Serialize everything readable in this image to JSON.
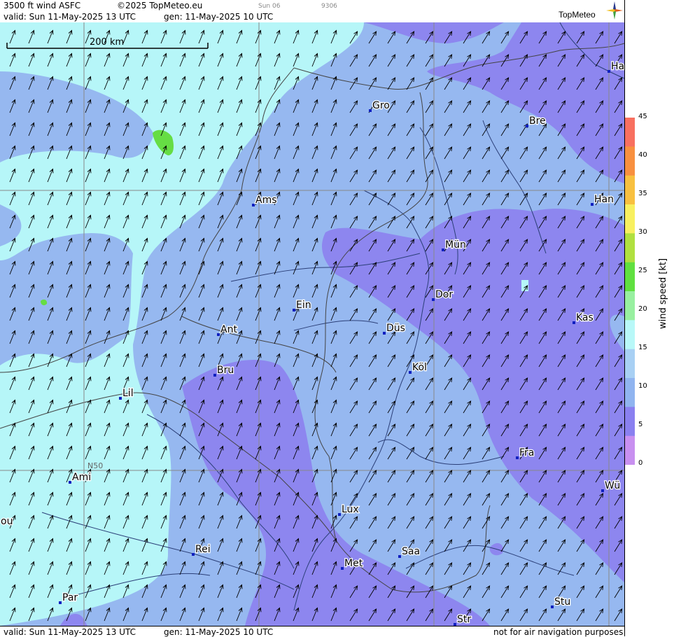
{
  "header": {
    "product": "3500 ft wind ASFC",
    "copyright": "©2025 TopMeteo.eu",
    "slot_day": "Sun 06",
    "slot_code": "9306",
    "valid": "valid:  Sun  11-May-2025  13 UTC",
    "gen": "gen: 11-May-2025 10 UTC",
    "logo": "TopMeteo"
  },
  "footer": {
    "valid": "valid:  Sun  11-May-2025  13 UTC",
    "gen": "gen: 11-May-2025 10 UTC",
    "disclaimer": "not for air navigation purposes"
  },
  "scale_bar": {
    "label": "200 km"
  },
  "grid_label": "N50",
  "cities": [
    {
      "abbr": "Ha"
    },
    {
      "abbr": "Gro"
    },
    {
      "abbr": "Bre"
    },
    {
      "abbr": "Ams"
    },
    {
      "abbr": "Han"
    },
    {
      "abbr": "Mün"
    },
    {
      "abbr": "Dor"
    },
    {
      "abbr": "Ein"
    },
    {
      "abbr": "Kas"
    },
    {
      "abbr": "Ant"
    },
    {
      "abbr": "Düs"
    },
    {
      "abbr": "Bru"
    },
    {
      "abbr": "Köl"
    },
    {
      "abbr": "Lil"
    },
    {
      "abbr": "Fra"
    },
    {
      "abbr": "Ami"
    },
    {
      "abbr": "Wü"
    },
    {
      "abbr": "ou"
    },
    {
      "abbr": "Lux"
    },
    {
      "abbr": "Rei"
    },
    {
      "abbr": "Saa"
    },
    {
      "abbr": "Met"
    },
    {
      "abbr": "Par"
    },
    {
      "abbr": "Stu"
    },
    {
      "abbr": "Str"
    }
  ],
  "colorbar": {
    "label": "wind  speed  [kt]",
    "ticks": [
      "0",
      "5",
      "10",
      "15",
      "20",
      "25",
      "30",
      "35",
      "40",
      "45"
    ],
    "colors": [
      "#c890f0",
      "#8a80f0",
      "#90b4f0",
      "#a8d0f4",
      "#b8f8f8",
      "#98f0a0",
      "#60e040",
      "#b0e040",
      "#f8f060",
      "#f8c040",
      "#f89040",
      "#f87060"
    ]
  },
  "colors": {
    "calm_purple": "#8d86ef",
    "light_blue": "#96b8f0",
    "cyan": "#b6f6f8",
    "green": "#66dd44",
    "border": "#444444",
    "river": "#2b3f78"
  }
}
